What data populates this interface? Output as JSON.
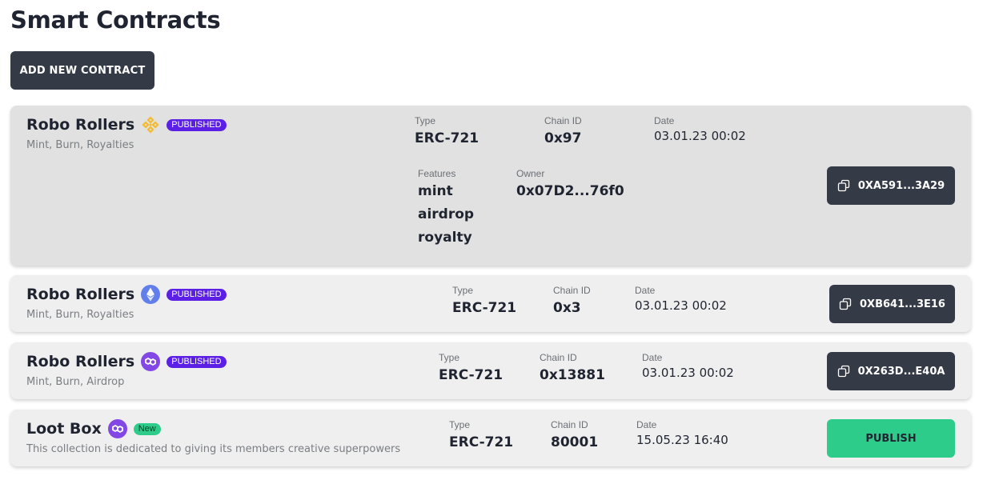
{
  "page": {
    "title": "Smart Contracts"
  },
  "toolbar": {
    "add_label": "ADD NEW CONTRACT"
  },
  "labels": {
    "type": "Type",
    "chain_id": "Chain ID",
    "date": "Date",
    "features": "Features",
    "owner": "Owner"
  },
  "contracts": [
    {
      "name": "Robo Rollers",
      "chain_icon": "bnb-icon",
      "status": "PUBLISHED",
      "description": "Mint, Burn, Royalties",
      "type": "ERC-721",
      "chain_id": "0x97",
      "date": "03.01.23 00:02",
      "features": [
        "mint",
        "airdrop",
        "royalty"
      ],
      "owner": "0x07D2...76f0",
      "address": "0XA591...3A29"
    },
    {
      "name": "Robo Rollers",
      "chain_icon": "ethereum-icon",
      "status": "PUBLISHED",
      "description": "Mint, Burn, Royalties",
      "type": "ERC-721",
      "chain_id": "0x3",
      "date": "03.01.23 00:02",
      "address": "0XB641...3E16"
    },
    {
      "name": "Robo Rollers",
      "chain_icon": "polygon-icon",
      "status": "PUBLISHED",
      "description": "Mint, Burn, Airdrop",
      "type": "ERC-721",
      "chain_id": "0x13881",
      "date": "03.01.23 00:02",
      "address": "0X263D...E40A"
    },
    {
      "name": "Loot Box",
      "chain_icon": "polygon-icon",
      "status": "New",
      "description": "This collection is dedicated to giving its members creative superpowers",
      "type": "ERC-721",
      "chain_id": "80001",
      "date": "15.05.23 16:40",
      "action_label": "PUBLISH"
    }
  ],
  "colors": {
    "dark_button": "#343a46",
    "published_badge": "#5b1fe6",
    "new_badge": "#2ecc8a",
    "publish_button": "#2ecc8a",
    "bnb": "#f3ba2f",
    "ethereum": "#627eea",
    "polygon": "#8247e5"
  }
}
